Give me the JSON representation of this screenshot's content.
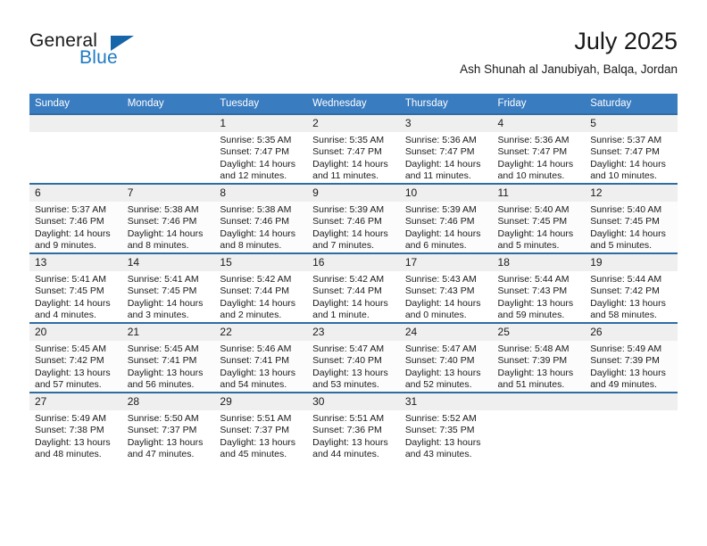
{
  "brand": {
    "name_part1": "General",
    "name_part2": "Blue",
    "triangle_color": "#1565a8",
    "blue_color": "#1f7ac4"
  },
  "header": {
    "title": "July 2025",
    "subtitle": "Ash Shunah al Janubiyah, Balqa, Jordan"
  },
  "theme": {
    "header_bg": "#3a7cc0",
    "row_border": "#2e6da4",
    "daynum_bg": "#efefef"
  },
  "weekdays": [
    "Sunday",
    "Monday",
    "Tuesday",
    "Wednesday",
    "Thursday",
    "Friday",
    "Saturday"
  ],
  "weeks": [
    [
      {
        "day": "",
        "lines": []
      },
      {
        "day": "",
        "lines": []
      },
      {
        "day": "1",
        "lines": [
          "Sunrise: 5:35 AM",
          "Sunset: 7:47 PM",
          "Daylight: 14 hours",
          "and 12 minutes."
        ]
      },
      {
        "day": "2",
        "lines": [
          "Sunrise: 5:35 AM",
          "Sunset: 7:47 PM",
          "Daylight: 14 hours",
          "and 11 minutes."
        ]
      },
      {
        "day": "3",
        "lines": [
          "Sunrise: 5:36 AM",
          "Sunset: 7:47 PM",
          "Daylight: 14 hours",
          "and 11 minutes."
        ]
      },
      {
        "day": "4",
        "lines": [
          "Sunrise: 5:36 AM",
          "Sunset: 7:47 PM",
          "Daylight: 14 hours",
          "and 10 minutes."
        ]
      },
      {
        "day": "5",
        "lines": [
          "Sunrise: 5:37 AM",
          "Sunset: 7:47 PM",
          "Daylight: 14 hours",
          "and 10 minutes."
        ]
      }
    ],
    [
      {
        "day": "6",
        "lines": [
          "Sunrise: 5:37 AM",
          "Sunset: 7:46 PM",
          "Daylight: 14 hours",
          "and 9 minutes."
        ]
      },
      {
        "day": "7",
        "lines": [
          "Sunrise: 5:38 AM",
          "Sunset: 7:46 PM",
          "Daylight: 14 hours",
          "and 8 minutes."
        ]
      },
      {
        "day": "8",
        "lines": [
          "Sunrise: 5:38 AM",
          "Sunset: 7:46 PM",
          "Daylight: 14 hours",
          "and 8 minutes."
        ]
      },
      {
        "day": "9",
        "lines": [
          "Sunrise: 5:39 AM",
          "Sunset: 7:46 PM",
          "Daylight: 14 hours",
          "and 7 minutes."
        ]
      },
      {
        "day": "10",
        "lines": [
          "Sunrise: 5:39 AM",
          "Sunset: 7:46 PM",
          "Daylight: 14 hours",
          "and 6 minutes."
        ]
      },
      {
        "day": "11",
        "lines": [
          "Sunrise: 5:40 AM",
          "Sunset: 7:45 PM",
          "Daylight: 14 hours",
          "and 5 minutes."
        ]
      },
      {
        "day": "12",
        "lines": [
          "Sunrise: 5:40 AM",
          "Sunset: 7:45 PM",
          "Daylight: 14 hours",
          "and 5 minutes."
        ]
      }
    ],
    [
      {
        "day": "13",
        "lines": [
          "Sunrise: 5:41 AM",
          "Sunset: 7:45 PM",
          "Daylight: 14 hours",
          "and 4 minutes."
        ]
      },
      {
        "day": "14",
        "lines": [
          "Sunrise: 5:41 AM",
          "Sunset: 7:45 PM",
          "Daylight: 14 hours",
          "and 3 minutes."
        ]
      },
      {
        "day": "15",
        "lines": [
          "Sunrise: 5:42 AM",
          "Sunset: 7:44 PM",
          "Daylight: 14 hours",
          "and 2 minutes."
        ]
      },
      {
        "day": "16",
        "lines": [
          "Sunrise: 5:42 AM",
          "Sunset: 7:44 PM",
          "Daylight: 14 hours",
          "and 1 minute."
        ]
      },
      {
        "day": "17",
        "lines": [
          "Sunrise: 5:43 AM",
          "Sunset: 7:43 PM",
          "Daylight: 14 hours",
          "and 0 minutes."
        ]
      },
      {
        "day": "18",
        "lines": [
          "Sunrise: 5:44 AM",
          "Sunset: 7:43 PM",
          "Daylight: 13 hours",
          "and 59 minutes."
        ]
      },
      {
        "day": "19",
        "lines": [
          "Sunrise: 5:44 AM",
          "Sunset: 7:42 PM",
          "Daylight: 13 hours",
          "and 58 minutes."
        ]
      }
    ],
    [
      {
        "day": "20",
        "lines": [
          "Sunrise: 5:45 AM",
          "Sunset: 7:42 PM",
          "Daylight: 13 hours",
          "and 57 minutes."
        ]
      },
      {
        "day": "21",
        "lines": [
          "Sunrise: 5:45 AM",
          "Sunset: 7:41 PM",
          "Daylight: 13 hours",
          "and 56 minutes."
        ]
      },
      {
        "day": "22",
        "lines": [
          "Sunrise: 5:46 AM",
          "Sunset: 7:41 PM",
          "Daylight: 13 hours",
          "and 54 minutes."
        ]
      },
      {
        "day": "23",
        "lines": [
          "Sunrise: 5:47 AM",
          "Sunset: 7:40 PM",
          "Daylight: 13 hours",
          "and 53 minutes."
        ]
      },
      {
        "day": "24",
        "lines": [
          "Sunrise: 5:47 AM",
          "Sunset: 7:40 PM",
          "Daylight: 13 hours",
          "and 52 minutes."
        ]
      },
      {
        "day": "25",
        "lines": [
          "Sunrise: 5:48 AM",
          "Sunset: 7:39 PM",
          "Daylight: 13 hours",
          "and 51 minutes."
        ]
      },
      {
        "day": "26",
        "lines": [
          "Sunrise: 5:49 AM",
          "Sunset: 7:39 PM",
          "Daylight: 13 hours",
          "and 49 minutes."
        ]
      }
    ],
    [
      {
        "day": "27",
        "lines": [
          "Sunrise: 5:49 AM",
          "Sunset: 7:38 PM",
          "Daylight: 13 hours",
          "and 48 minutes."
        ]
      },
      {
        "day": "28",
        "lines": [
          "Sunrise: 5:50 AM",
          "Sunset: 7:37 PM",
          "Daylight: 13 hours",
          "and 47 minutes."
        ]
      },
      {
        "day": "29",
        "lines": [
          "Sunrise: 5:51 AM",
          "Sunset: 7:37 PM",
          "Daylight: 13 hours",
          "and 45 minutes."
        ]
      },
      {
        "day": "30",
        "lines": [
          "Sunrise: 5:51 AM",
          "Sunset: 7:36 PM",
          "Daylight: 13 hours",
          "and 44 minutes."
        ]
      },
      {
        "day": "31",
        "lines": [
          "Sunrise: 5:52 AM",
          "Sunset: 7:35 PM",
          "Daylight: 13 hours",
          "and 43 minutes."
        ]
      },
      {
        "day": "",
        "lines": []
      },
      {
        "day": "",
        "lines": []
      }
    ]
  ]
}
